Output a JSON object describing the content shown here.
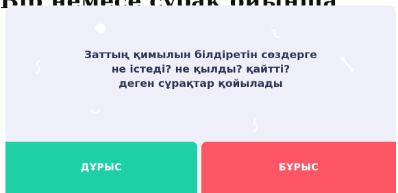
{
  "header": {
    "clipped_text": "Бір немесе сұрақ ойынша"
  },
  "question": {
    "lines": [
      "Заттың қимылын білдіретін сөздерге",
      "не істеді? не қылды? қайтті?",
      "деген сұрақтар қойылады"
    ]
  },
  "answers": {
    "correct_label": "ДҰРЫС",
    "wrong_label": "БҰРЫС"
  },
  "colors": {
    "card_background": "#eeeff8",
    "question_text": "#2b3553",
    "correct_button": "#1fcfa6",
    "wrong_button": "#fc5664",
    "button_text": "#ffffff"
  },
  "decorations": [
    "blob-shape-icon",
    "squiggle-shape-icon",
    "curl-shape-icon",
    "bone-shape-icon",
    "crescent-shape-icon",
    "squiggle-shape-icon"
  ]
}
